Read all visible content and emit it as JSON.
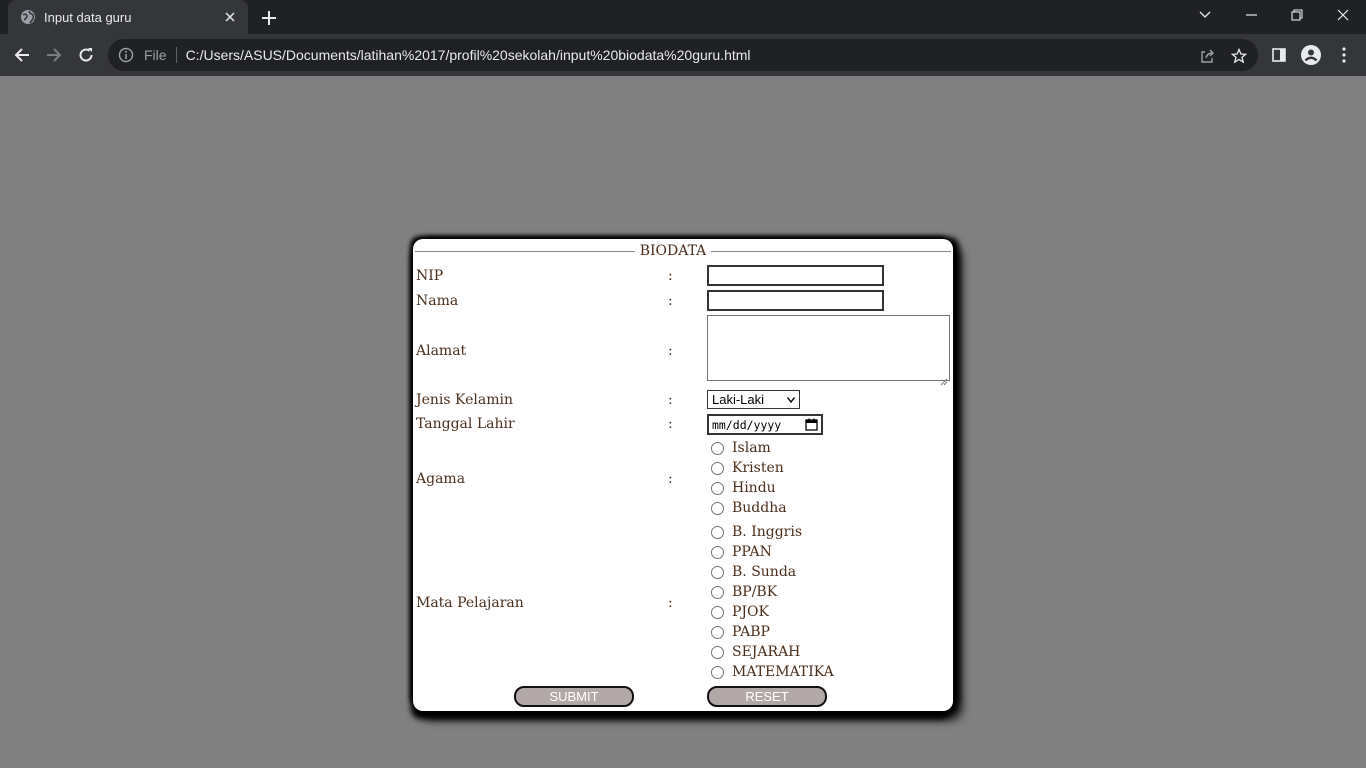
{
  "browser": {
    "tab_title": "Input data guru",
    "omnibox_file_label": "File",
    "url": "C:/Users/ASUS/Documents/latihan%2017/profil%20sekolah/input%20biodata%20guru.html"
  },
  "form": {
    "legend": "BIODATA",
    "separator": ":",
    "fields": {
      "nip": {
        "label": "NIP",
        "value": ""
      },
      "nama": {
        "label": "Nama",
        "value": ""
      },
      "alamat": {
        "label": "Alamat",
        "value": ""
      },
      "jenis_kelamin": {
        "label": "Jenis Kelamin",
        "selected": "Laki-Laki"
      },
      "tanggal_lahir": {
        "label": "Tanggal Lahir",
        "placeholder": "mm/dd/yyyy"
      },
      "agama": {
        "label": "Agama",
        "options": [
          "Islam",
          "Kristen",
          "Hindu",
          "Buddha"
        ]
      },
      "mata_pelajaran": {
        "label": "Mata Pelajaran",
        "options": [
          "B. Inggris",
          "PPAN",
          "B. Sunda",
          "BP/BK",
          "PJOK",
          "PABP",
          "SEJARAH",
          "MATEMATIKA"
        ]
      }
    },
    "buttons": {
      "submit": "SUBMIT",
      "reset": "RESET"
    }
  },
  "colors": {
    "page_background": "#808080",
    "label_text": "#4a2f1c",
    "button_fill": "#b3a8a8",
    "chrome_dark": "#202124",
    "chrome_toolbar": "#35363a"
  },
  "icons": [
    "globe-icon",
    "close-icon",
    "plus-icon",
    "minimize-icon",
    "restore-icon",
    "back-arrow-icon",
    "forward-arrow-icon",
    "reload-icon",
    "info-icon",
    "share-icon",
    "star-icon",
    "side-panel-icon",
    "profile-icon",
    "more-vert-icon",
    "calendar-icon",
    "dropdown-arrow-icon"
  ]
}
